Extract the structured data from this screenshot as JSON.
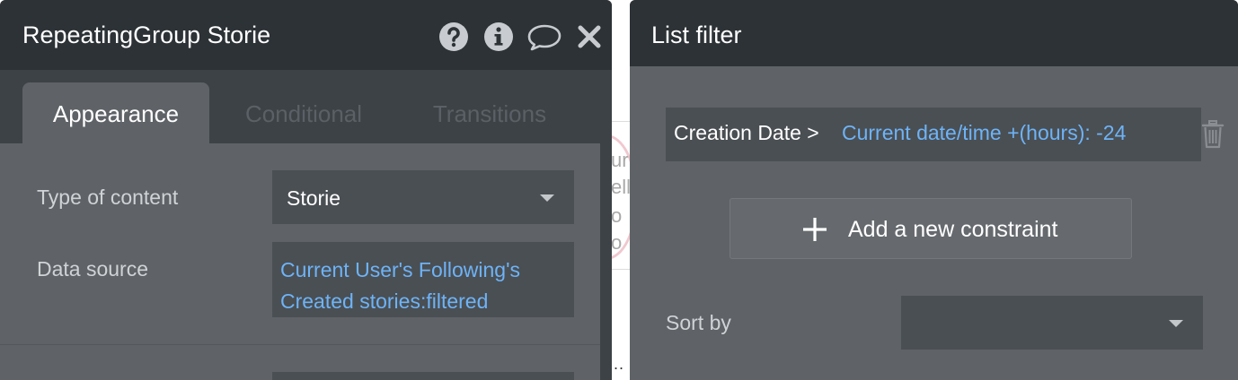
{
  "properties_panel": {
    "title": "RepeatingGroup Storie",
    "header_icons": [
      "help-icon",
      "info-icon",
      "comment-icon",
      "close-icon"
    ],
    "tabs": [
      {
        "label": "Appearance",
        "active": true
      },
      {
        "label": "Conditional",
        "active": false
      },
      {
        "label": "Transitions",
        "active": false
      }
    ],
    "type_of_content": {
      "label": "Type of content",
      "value": "Storie"
    },
    "data_source": {
      "label": "Data source",
      "value_lines": [
        "Current User's Following's",
        "Created stories:filtered"
      ]
    }
  },
  "filter_panel": {
    "title": "List filter",
    "constraint": {
      "field": "Creation Date >",
      "value": "Current date/time +(hours): -24"
    },
    "add_button_label": "Add a new constraint",
    "sort_by_label": "Sort by",
    "sort_by_value": ""
  },
  "background": {
    "partial_text": [
      "ur",
      "ell",
      "o",
      "o"
    ],
    "dots": ".."
  },
  "colors": {
    "panel_bg": "#5f6367",
    "header_bg": "#2c3236",
    "field_bg": "#4a4f53",
    "expression_blue": "#6eb3f7"
  }
}
